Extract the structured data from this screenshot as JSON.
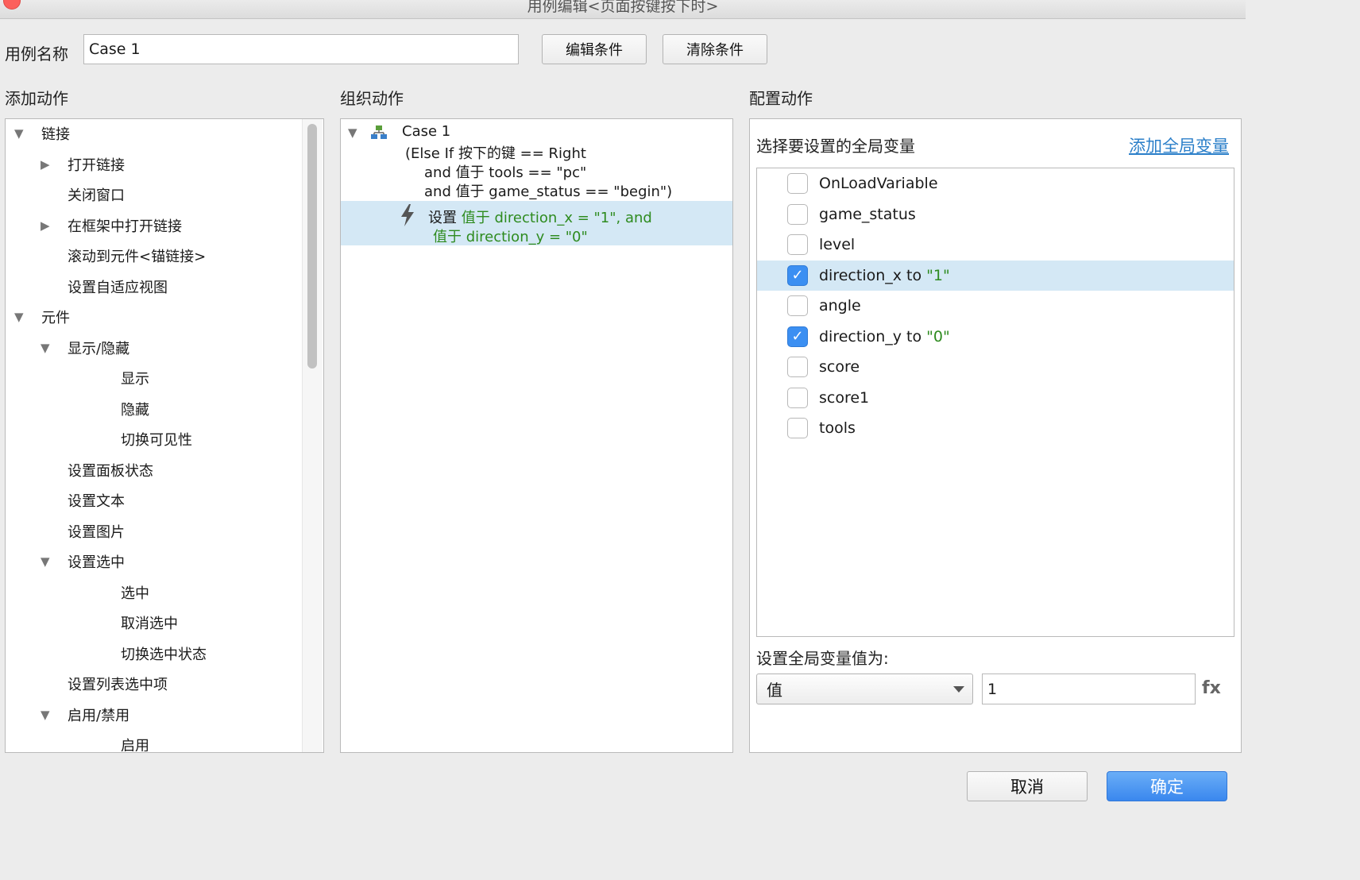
{
  "window": {
    "title": "用例编辑<页面按键按下时>"
  },
  "case_name": {
    "label": "用例名称",
    "value": "Case 1"
  },
  "toolbar": {
    "edit_condition": "编辑条件",
    "clear_condition": "清除条件"
  },
  "sections": {
    "add_actions": "添加动作",
    "organize_actions": "组织动作",
    "configure_actions": "配置动作"
  },
  "add_actions_tree": [
    {
      "label": "链接",
      "level": 0,
      "expander": "expanded"
    },
    {
      "label": "打开链接",
      "level": 1,
      "expander": "collapsed"
    },
    {
      "label": "关闭窗口",
      "level": 1,
      "expander": "none"
    },
    {
      "label": "在框架中打开链接",
      "level": 1,
      "expander": "collapsed"
    },
    {
      "label": "滚动到元件<锚链接>",
      "level": 1,
      "expander": "none"
    },
    {
      "label": "设置自适应视图",
      "level": 1,
      "expander": "none"
    },
    {
      "label": "元件",
      "level": 0,
      "expander": "expanded"
    },
    {
      "label": "显示/隐藏",
      "level": 1,
      "expander": "expanded"
    },
    {
      "label": "显示",
      "level": 2,
      "expander": "none"
    },
    {
      "label": "隐藏",
      "level": 2,
      "expander": "none"
    },
    {
      "label": "切换可见性",
      "level": 2,
      "expander": "none"
    },
    {
      "label": "设置面板状态",
      "level": 1,
      "expander": "none"
    },
    {
      "label": "设置文本",
      "level": 1,
      "expander": "none"
    },
    {
      "label": "设置图片",
      "level": 1,
      "expander": "none"
    },
    {
      "label": "设置选中",
      "level": 1,
      "expander": "expanded"
    },
    {
      "label": "选中",
      "level": 2,
      "expander": "none"
    },
    {
      "label": "取消选中",
      "level": 2,
      "expander": "none"
    },
    {
      "label": "切换选中状态",
      "level": 2,
      "expander": "none"
    },
    {
      "label": "设置列表选中项",
      "level": 1,
      "expander": "none"
    },
    {
      "label": "启用/禁用",
      "level": 1,
      "expander": "expanded"
    },
    {
      "label": "启用",
      "level": 2,
      "expander": "none"
    }
  ],
  "organize": {
    "case_title": "Case 1",
    "condition_lines": [
      "(Else If 按下的键 == Right",
      "and 值于 tools == \"pc\"",
      "and 值于 game_status == \"begin\")"
    ],
    "action_prefix": "设置",
    "action_line1": "值于 direction_x = \"1\", and",
    "action_line2": "值于 direction_y = \"0\""
  },
  "configure": {
    "choose_label": "选择要设置的全局变量",
    "add_global_link": "添加全局变量",
    "variables": [
      {
        "name": "OnLoadVariable",
        "checked": false,
        "assignment": ""
      },
      {
        "name": "game_status",
        "checked": false,
        "assignment": ""
      },
      {
        "name": "level",
        "checked": false,
        "assignment": ""
      },
      {
        "name": "direction_x to ",
        "checked": true,
        "assignment": "\"1\""
      },
      {
        "name": "angle",
        "checked": false,
        "assignment": ""
      },
      {
        "name": "direction_y to ",
        "checked": true,
        "assignment": "\"0\""
      },
      {
        "name": "score",
        "checked": false,
        "assignment": ""
      },
      {
        "name": "score1",
        "checked": false,
        "assignment": ""
      },
      {
        "name": "tools",
        "checked": false,
        "assignment": ""
      }
    ],
    "selected_index": 3,
    "set_value_label": "设置全局变量值为:",
    "value_type": "值",
    "value_input": "1",
    "fx_label": "fx"
  },
  "footer": {
    "cancel": "取消",
    "ok": "确定"
  },
  "colors": {
    "accent": "#3b8ff2",
    "selection": "#d4e8f5",
    "green_text": "#2e8b1f",
    "link": "#2b7fc9"
  }
}
